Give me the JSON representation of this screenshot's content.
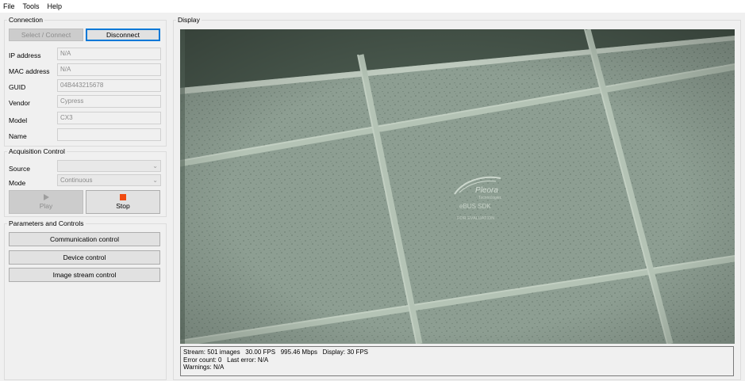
{
  "menu": [
    "File",
    "Tools",
    "Help"
  ],
  "connection": {
    "title": "Connection",
    "select_connect": "Select / Connect",
    "disconnect": "Disconnect",
    "fields": [
      {
        "label": "IP address",
        "value": "N/A"
      },
      {
        "label": "MAC address",
        "value": "N/A"
      },
      {
        "label": "GUID",
        "value": "04B443215678"
      },
      {
        "label": "Vendor",
        "value": "Cypress"
      },
      {
        "label": "Model",
        "value": "CX3"
      },
      {
        "label": "Name",
        "value": ""
      }
    ]
  },
  "acquisition": {
    "title": "Acquisition Control",
    "source_label": "Source",
    "source_value": "",
    "mode_label": "Mode",
    "mode_value": "Continuous",
    "play": "Play",
    "stop": "Stop"
  },
  "parameters": {
    "title": "Parameters and Controls",
    "buttons": [
      "Communication control",
      "Device control",
      "Image stream control"
    ]
  },
  "display": {
    "title": "Display",
    "watermark": {
      "brand": "Pleora",
      "sub": "Technologies",
      "product": "eBUS SDK",
      "note": "FOR EVALUATION"
    }
  },
  "status": {
    "line1": "Stream: 501 images   30.00 FPS   995.46 Mbps   Display: 30 FPS",
    "line2": "Error count: 0   Last error: N/A",
    "line3": "Warnings: N/A"
  },
  "colors": {
    "accent": "#0078d7",
    "stop_icon": "#f04a10",
    "ceiling_tile": "#8b9c90",
    "ceiling_grid": "#b2c2b4"
  }
}
